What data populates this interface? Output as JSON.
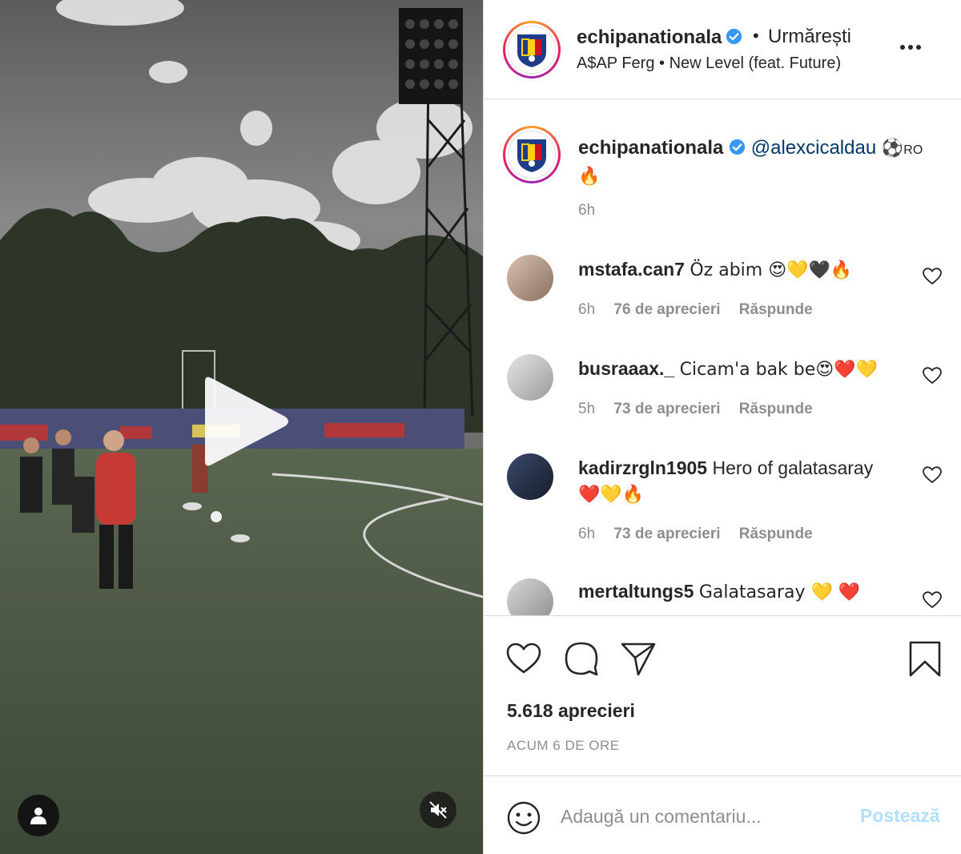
{
  "post": {
    "author": "echipanationala",
    "follow_separator": "•",
    "follow_label": "Urmărești",
    "song": "A$AP Ferg • New Level (feat. Future)",
    "caption": {
      "author": "echipanationala",
      "mention": "@alexcicaldau",
      "emoji_text": "⚽",
      "tag": "RO",
      "emoji_line2": "🔥",
      "time": "6h"
    }
  },
  "comments": [
    {
      "user": "mstafa.can7",
      "text": "Öz abim 😍💛🖤🔥",
      "time": "6h",
      "likes": "76 de aprecieri",
      "reply": "Răspunde"
    },
    {
      "user": "busraaax._",
      "text": "Cicam'a bak be😍❤️💛",
      "time": "5h",
      "likes": "73 de aprecieri",
      "reply": "Răspunde"
    },
    {
      "user": "kadirzrgln1905",
      "text": "Hero of galatasaray",
      "text2": "❤️💛🔥",
      "time": "6h",
      "likes": "73 de aprecieri",
      "reply": "Răspunde"
    },
    {
      "user": "mertaltungs5",
      "text": "Galatasaray 💛 ❤️",
      "time": "",
      "likes": "",
      "reply": ""
    }
  ],
  "stats": {
    "likes": "5.618 aprecieri",
    "posted": "ACUM 6 DE ORE"
  },
  "composer": {
    "placeholder": "Adaugă un comentariu...",
    "post_label": "Postează"
  },
  "icons": {
    "more": "more-dots-icon",
    "like": "heart-icon",
    "comment": "comment-bubble-icon",
    "share": "paper-plane-icon",
    "save": "bookmark-icon",
    "emoji": "smiley-icon",
    "play": "play-icon",
    "mute": "speaker-muted-icon",
    "user_tag": "person-icon"
  },
  "colors": {
    "link": "#00376b",
    "muted": "#8e8e8e",
    "post_disabled": "#b2dffc",
    "verified": "#3897f0"
  }
}
